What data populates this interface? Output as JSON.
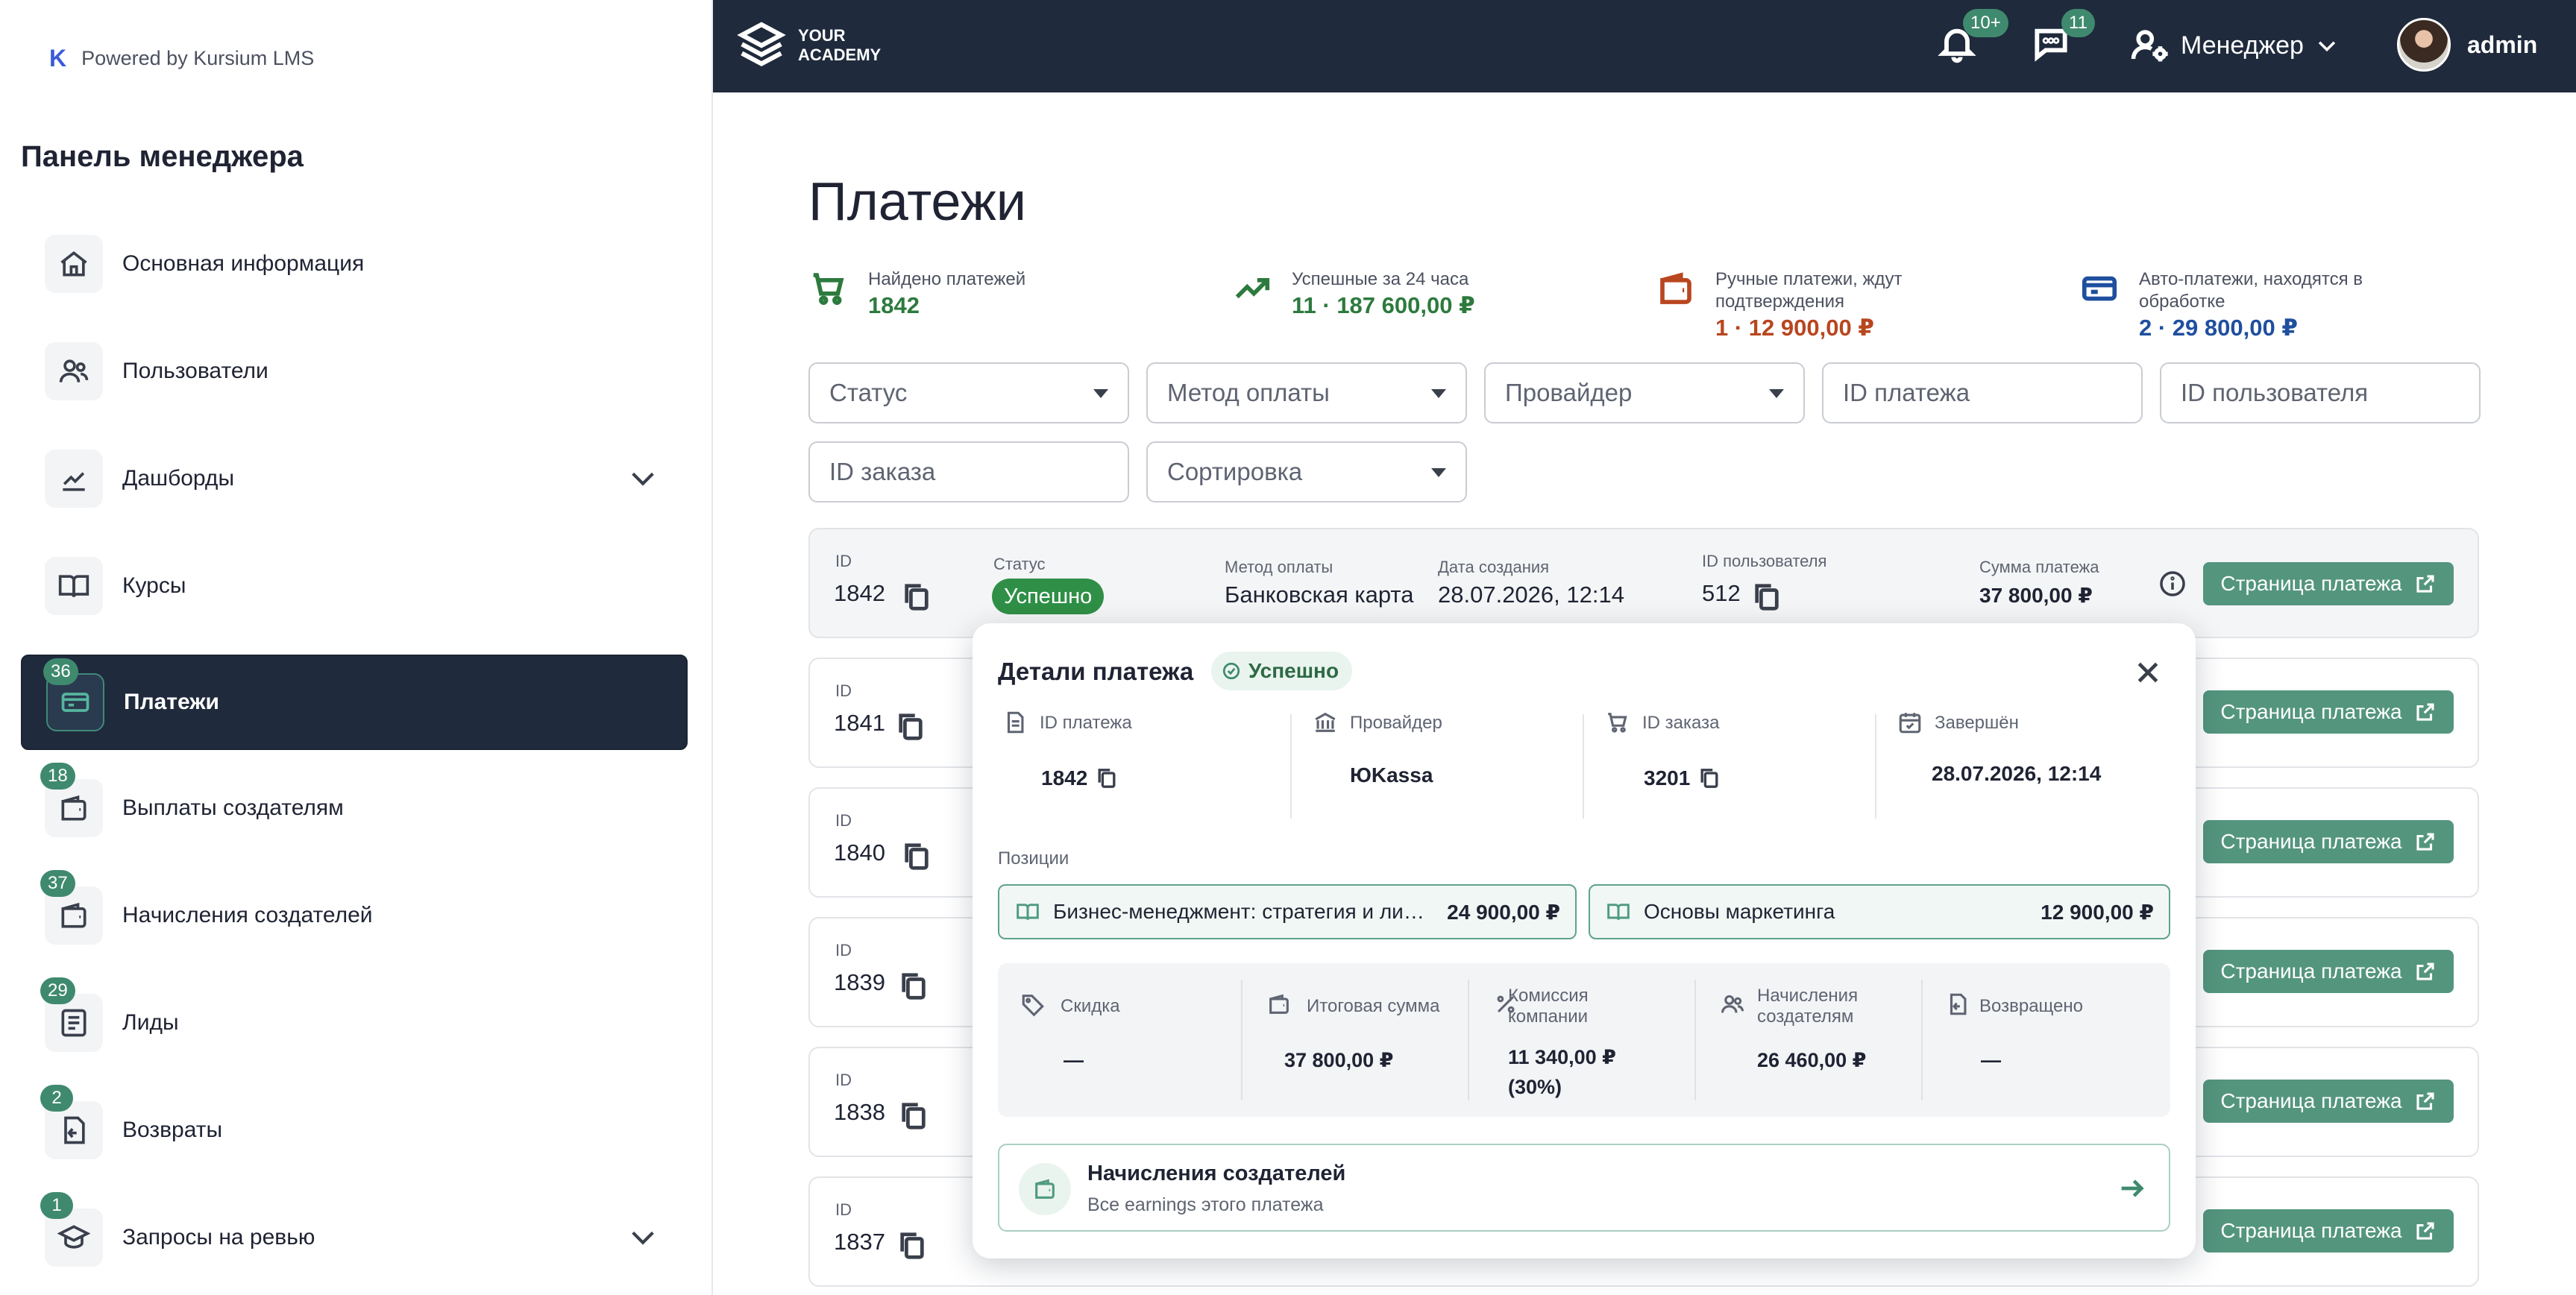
{
  "sidebar": {
    "powered": "Powered by Kursium LMS",
    "powered_logo": "K",
    "title": "Панель менеджера",
    "items": [
      {
        "label": "Основная информация",
        "icon": "home-icon",
        "badge": ""
      },
      {
        "label": "Пользователи",
        "icon": "users-icon",
        "badge": ""
      },
      {
        "label": "Дашборды",
        "icon": "chart-line-icon",
        "badge": ""
      },
      {
        "label": "Курсы",
        "icon": "book-icon",
        "badge": ""
      },
      {
        "label": "Платежи",
        "icon": "card-icon",
        "badge": "36"
      },
      {
        "label": "Выплаты создателям",
        "icon": "wallet-icon",
        "badge": "18"
      },
      {
        "label": "Начисления создателей",
        "icon": "wallet-icon",
        "badge": "37"
      },
      {
        "label": "Лиды",
        "icon": "list-icon",
        "badge": "29"
      },
      {
        "label": "Возвраты",
        "icon": "return-icon",
        "badge": "2"
      },
      {
        "label": "Запросы на ревью",
        "icon": "graduation-cap-icon",
        "badge": "1"
      }
    ]
  },
  "topbar": {
    "logo_line1": "YOUR",
    "logo_line2": "ACADEMY",
    "notifications_badge": "10+",
    "messages_badge": "11",
    "role": "Менеджер",
    "username": "admin"
  },
  "main": {
    "title": "Платежи",
    "stats": [
      {
        "label": "Найдено платежей",
        "label2": "",
        "value": "1842",
        "color": "#2d7a3e"
      },
      {
        "label": "Успешные за 24 часа",
        "label2": "",
        "value": "11 · 187 600,00 ₽",
        "color": "#2d7a3e"
      },
      {
        "label": "Ручные платежи, ждут",
        "label2": "подтверждения",
        "value": "1 · 12 900,00 ₽",
        "color": "#b8461f"
      },
      {
        "label": "Авто-платежи, находятся в",
        "label2": "обработке",
        "value": "2 · 29 800,00 ₽",
        "color": "#1f4f9e"
      }
    ],
    "filters": {
      "status": "Статус",
      "method": "Метод оплаты",
      "provider": "Провайдер",
      "payment_id": "ID платежа",
      "user_id": "ID пользователя",
      "order_id": "ID заказа",
      "sort": "Сортировка"
    },
    "labels": {
      "id": "ID",
      "status": "Статус",
      "method": "Метод оплаты",
      "created": "Дата создания",
      "user_id": "ID пользователя",
      "amount": "Сумма платежа",
      "page_button": "Страница платежа"
    },
    "rows": [
      {
        "id": "1842",
        "status": "Успешно",
        "method": "Банковская карта",
        "created": "28.07.2026, 12:14",
        "user_id": "512",
        "amount": "37 800,00 ₽"
      },
      {
        "id": "1841"
      },
      {
        "id": "1840"
      },
      {
        "id": "1839"
      },
      {
        "id": "1838"
      },
      {
        "id": "1837"
      }
    ]
  },
  "popover": {
    "title": "Детали платежа",
    "status": "Успешно",
    "meta": [
      {
        "label": "ID платежа",
        "value": "1842",
        "icon": "document-icon"
      },
      {
        "label": "Провайдер",
        "value": "ЮKassa",
        "icon": "bank-icon"
      },
      {
        "label": "ID заказа",
        "value": "3201",
        "icon": "cart-icon"
      },
      {
        "label": "Завершён",
        "value": "28.07.2026, 12:14",
        "icon": "calendar-icon"
      }
    ],
    "positions_label": "Позиции",
    "positions": [
      {
        "name": "Бизнес-менеджмент: стратегия и лидерство",
        "price": "24 900,00 ₽"
      },
      {
        "name": "Основы маркетинга",
        "price": "12 900,00 ₽"
      }
    ],
    "summary": [
      {
        "label": "Скидка",
        "value": "—",
        "icon": "tag-icon"
      },
      {
        "label": "Итоговая сумма",
        "value": "37 800,00 ₽",
        "icon": "wallet-icon"
      },
      {
        "label": "Комиссия компании",
        "value": "11 340,00 ₽ (30%)",
        "icon": "percent-icon"
      },
      {
        "label": "Начисления создателям",
        "value": "26 460,00 ₽",
        "icon": "users-icon"
      },
      {
        "label": "Возвращено",
        "value": "—",
        "icon": "refund-icon"
      }
    ],
    "earnings_title": "Начисления создателей",
    "earnings_sub": "Все earnings этого платежа"
  }
}
